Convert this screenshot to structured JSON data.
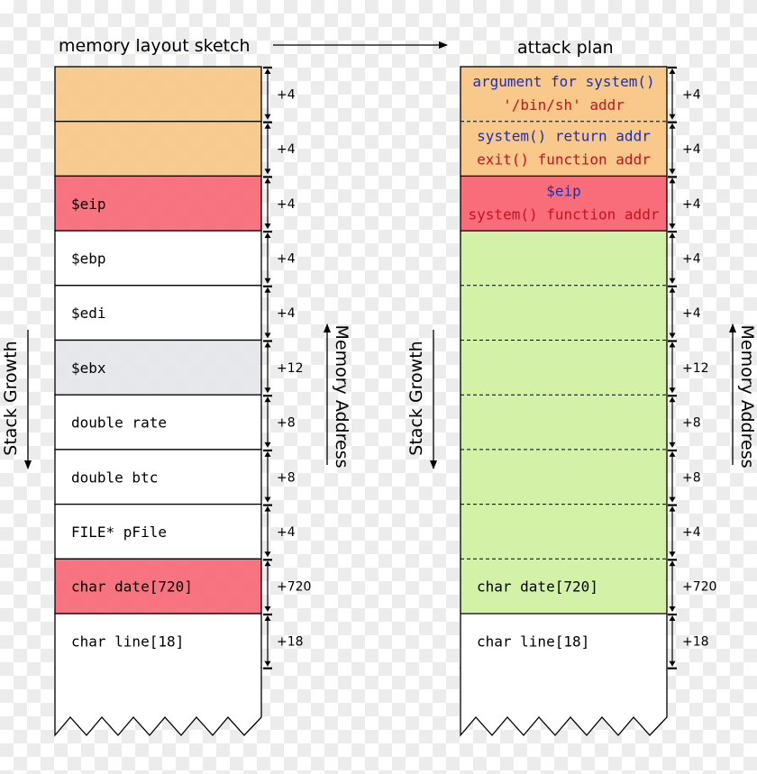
{
  "left": {
    "title": "memory layout sketch",
    "cells": [
      {
        "label": "",
        "size": "+4",
        "fill": "#f8c98a"
      },
      {
        "label": "",
        "size": "+4",
        "fill": "#f8c98a"
      },
      {
        "label": "$eip",
        "size": "+4",
        "fill": "#f86d79"
      },
      {
        "label": "$ebp",
        "size": "+4",
        "fill": "#ffffff"
      },
      {
        "label": "$edi",
        "size": "+4",
        "fill": "#ffffff"
      },
      {
        "label": "$ebx",
        "size": "+12",
        "fill": "#e5e7eb"
      },
      {
        "label": "double rate",
        "size": "+8",
        "fill": "#ffffff"
      },
      {
        "label": "double btc",
        "size": "+8",
        "fill": "#ffffff"
      },
      {
        "label": "FILE* pFile",
        "size": "+4",
        "fill": "#ffffff"
      },
      {
        "label": "char date[720]",
        "size": "+720",
        "fill": "#f86d79"
      },
      {
        "label": "char line[18]",
        "size": "+18",
        "fill": "#ffffff"
      }
    ],
    "stack_growth": "Stack Growth",
    "memory_address": "Memory Address"
  },
  "right": {
    "title": "attack plan",
    "cells": [
      {
        "line1": "argument for system()",
        "line2": "'/bin/sh' addr",
        "size": "+4",
        "fill": "#f8c98a"
      },
      {
        "line1": "system() return addr",
        "line2": "exit() function addr",
        "size": "+4",
        "fill": "#f8c98a"
      },
      {
        "line1": "$eip",
        "line2": "system() function addr",
        "size": "+4",
        "fill": "#f86d79"
      },
      {
        "line1": "",
        "line2": "",
        "size": "+4",
        "fill": "#d3f2a8"
      },
      {
        "line1": "",
        "line2": "",
        "size": "+4",
        "fill": "#d3f2a8"
      },
      {
        "line1": "",
        "line2": "",
        "size": "+12",
        "fill": "#d3f2a8"
      },
      {
        "line1": "",
        "line2": "",
        "size": "+8",
        "fill": "#d3f2a8"
      },
      {
        "line1": "",
        "line2": "",
        "size": "+8",
        "fill": "#d3f2a8"
      },
      {
        "line1": "",
        "line2": "",
        "size": "+4",
        "fill": "#d3f2a8"
      },
      {
        "line1": "char date[720]",
        "line2": "",
        "size": "+720",
        "fill": "#d3f2a8"
      },
      {
        "line1": "char line[18]",
        "line2": "",
        "size": "+18",
        "fill": "#ffffff"
      }
    ],
    "stack_growth": "Stack Growth",
    "memory_address": "Memory Address"
  },
  "colors": {
    "orange": "#f8c98a",
    "red": "#f86d79",
    "green": "#d3f2a8",
    "gray": "#e5e7eb",
    "blue_text": "#1a2fb8",
    "red_text": "#c8121e"
  }
}
